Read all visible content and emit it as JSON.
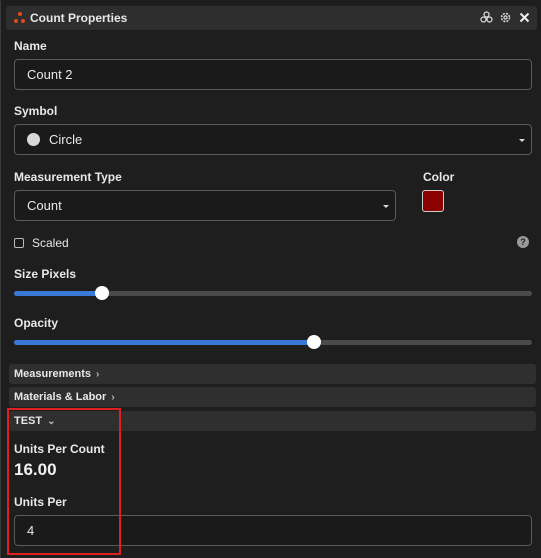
{
  "window": {
    "title": "Count Properties",
    "icons": [
      "layers-icon",
      "gear-icon",
      "close-icon"
    ]
  },
  "name": {
    "label": "Name",
    "value": "Count 2"
  },
  "symbol": {
    "label": "Symbol",
    "value": "Circle",
    "icon": "circle-icon"
  },
  "measurement_type": {
    "label": "Measurement Type",
    "value": "Count"
  },
  "color": {
    "label": "Color",
    "value": "#8b0000"
  },
  "scaled": {
    "label": "Scaled",
    "checked": false
  },
  "size_pixels": {
    "label": "Size Pixels",
    "level": 0.17
  },
  "opacity": {
    "label": "Opacity",
    "level": 0.58
  },
  "sections": {
    "measurements": "Measurements",
    "materials_labor": "Materials & Labor",
    "test": "TEST"
  },
  "test": {
    "units_per_count_label": "Units Per Count",
    "units_per_count_value": "16.00",
    "units_per_label": "Units Per",
    "units_per_value": "4"
  }
}
